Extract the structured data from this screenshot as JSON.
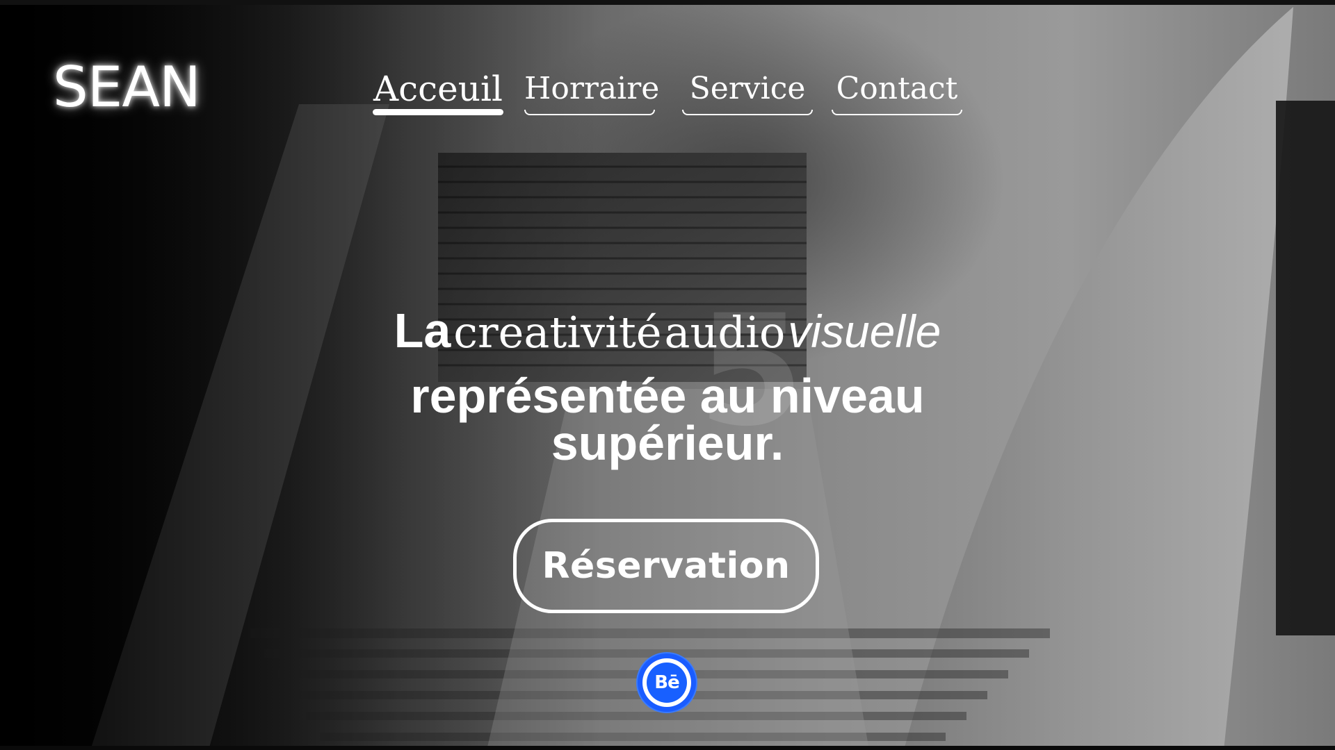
{
  "header": {
    "logo": "SEAN"
  },
  "nav": {
    "items": [
      {
        "label": "Acceuil",
        "active": true
      },
      {
        "label": "Horraire",
        "active": false
      },
      {
        "label": "Service",
        "active": false
      },
      {
        "label": "Contact",
        "active": false
      }
    ]
  },
  "hero": {
    "line1": {
      "word1": "La",
      "word2": "creativité",
      "word3": "audio",
      "word4": "visuelle"
    },
    "line2": "représentée au niveau",
    "line3": "supérieur."
  },
  "cta": {
    "label": "Réservation"
  },
  "social": {
    "behance_label": "Bē",
    "icon": "behance-icon",
    "color": "#1a5cff"
  },
  "colors": {
    "text": "#ffffff",
    "accent": "#1a5cff"
  }
}
